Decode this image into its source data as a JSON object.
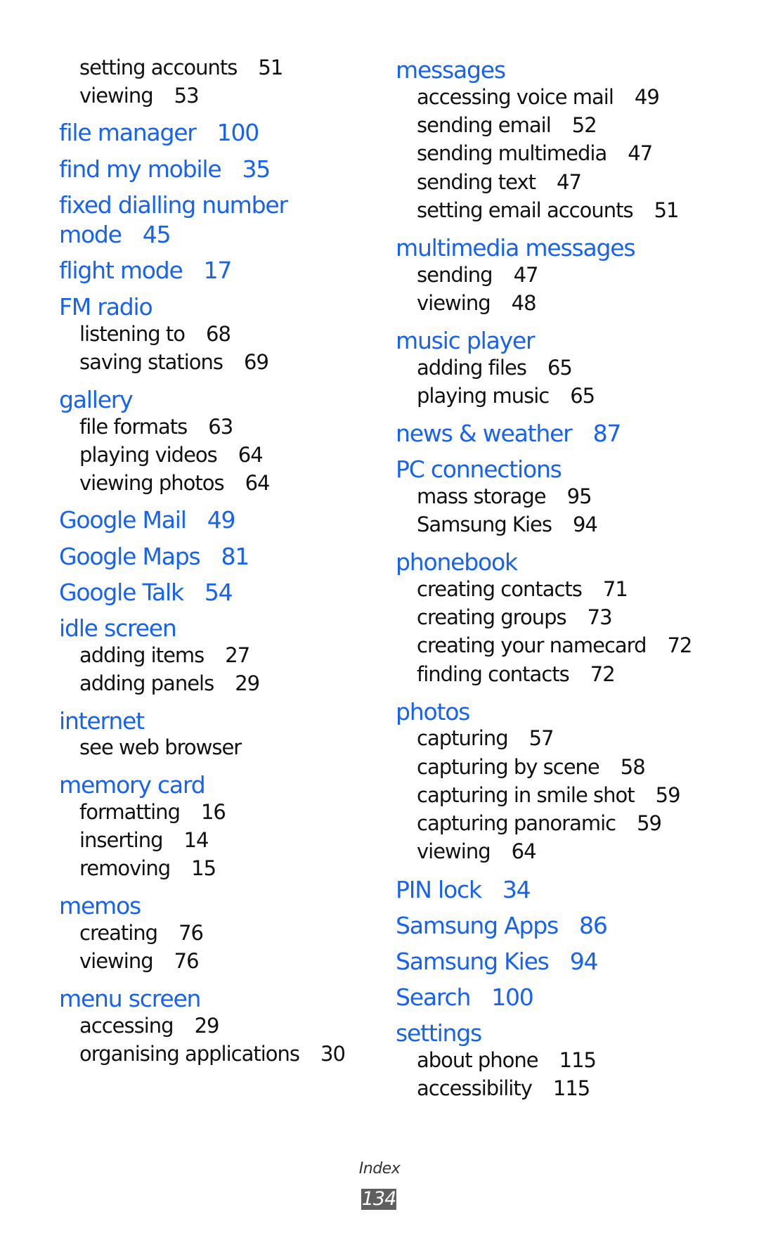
{
  "left_column": [
    {
      "type": "sub",
      "text": "setting accounts",
      "page": "51"
    },
    {
      "type": "sub",
      "text": "viewing",
      "page": "53"
    },
    {
      "type": "head",
      "text": "file manager",
      "page": "100"
    },
    {
      "type": "head",
      "text": "find my mobile",
      "page": "35"
    },
    {
      "type": "head",
      "text": "fixed dialling number",
      "page": ""
    },
    {
      "type": "head",
      "text": "mode",
      "page": "45"
    },
    {
      "type": "head",
      "text": "flight mode",
      "page": "17"
    },
    {
      "type": "head",
      "text": "FM radio",
      "page": ""
    },
    {
      "type": "sub",
      "text": "listening to",
      "page": "68"
    },
    {
      "type": "sub",
      "text": "saving stations",
      "page": "69"
    },
    {
      "type": "head",
      "text": "gallery",
      "page": ""
    },
    {
      "type": "sub",
      "text": "file formats",
      "page": "63"
    },
    {
      "type": "sub",
      "text": "playing videos",
      "page": "64"
    },
    {
      "type": "sub",
      "text": "viewing photos",
      "page": "64"
    },
    {
      "type": "head",
      "text": "Google Mail",
      "page": "49"
    },
    {
      "type": "head",
      "text": "Google Maps",
      "page": "81"
    },
    {
      "type": "head",
      "text": "Google Talk",
      "page": "54"
    },
    {
      "type": "head",
      "text": "idle screen",
      "page": ""
    },
    {
      "type": "sub",
      "text": "adding items",
      "page": "27"
    },
    {
      "type": "sub",
      "text": "adding panels",
      "page": "29"
    },
    {
      "type": "head",
      "text": "internet",
      "page": ""
    },
    {
      "type": "sub",
      "text": "see web browser",
      "page": ""
    },
    {
      "type": "head",
      "text": "memory card",
      "page": ""
    },
    {
      "type": "sub",
      "text": "formatting",
      "page": "16"
    },
    {
      "type": "sub",
      "text": "inserting",
      "page": "14"
    },
    {
      "type": "sub",
      "text": "removing",
      "page": "15"
    },
    {
      "type": "head",
      "text": "memos",
      "page": ""
    },
    {
      "type": "sub",
      "text": "creating",
      "page": "76"
    },
    {
      "type": "sub",
      "text": "viewing",
      "page": "76"
    },
    {
      "type": "head",
      "text": "menu screen",
      "page": ""
    },
    {
      "type": "sub",
      "text": "accessing",
      "page": "29"
    },
    {
      "type": "sub",
      "text": "organising applications",
      "page": "30"
    }
  ],
  "right_column": [
    {
      "type": "head",
      "text": "messages",
      "page": ""
    },
    {
      "type": "sub",
      "text": "accessing voice mail",
      "page": "49"
    },
    {
      "type": "sub",
      "text": "sending email",
      "page": "52"
    },
    {
      "type": "sub",
      "text": "sending multimedia",
      "page": "47"
    },
    {
      "type": "sub",
      "text": "sending text",
      "page": "47"
    },
    {
      "type": "sub",
      "text": "setting email accounts",
      "page": "51"
    },
    {
      "type": "head",
      "text": "multimedia messages",
      "page": ""
    },
    {
      "type": "sub",
      "text": "sending",
      "page": "47"
    },
    {
      "type": "sub",
      "text": "viewing",
      "page": "48"
    },
    {
      "type": "head",
      "text": "music player",
      "page": ""
    },
    {
      "type": "sub",
      "text": "adding files",
      "page": "65"
    },
    {
      "type": "sub",
      "text": "playing music",
      "page": "65"
    },
    {
      "type": "head",
      "text": "news & weather",
      "page": "87"
    },
    {
      "type": "head",
      "text": "PC connections",
      "page": ""
    },
    {
      "type": "sub",
      "text": "mass storage",
      "page": "95"
    },
    {
      "type": "sub",
      "text": "Samsung Kies",
      "page": "94"
    },
    {
      "type": "head",
      "text": "phonebook",
      "page": ""
    },
    {
      "type": "sub",
      "text": "creating contacts",
      "page": "71"
    },
    {
      "type": "sub",
      "text": "creating groups",
      "page": "73"
    },
    {
      "type": "sub",
      "text": "creating your namecard",
      "page": "72"
    },
    {
      "type": "sub",
      "text": "finding contacts",
      "page": "72"
    },
    {
      "type": "head",
      "text": "photos",
      "page": ""
    },
    {
      "type": "sub",
      "text": "capturing",
      "page": "57"
    },
    {
      "type": "sub",
      "text": "capturing by scene",
      "page": "58"
    },
    {
      "type": "sub",
      "text": "capturing in smile shot",
      "page": "59"
    },
    {
      "type": "sub",
      "text": "capturing panoramic",
      "page": "59"
    },
    {
      "type": "sub",
      "text": "viewing",
      "page": "64"
    },
    {
      "type": "head",
      "text": "PIN lock",
      "page": "34"
    },
    {
      "type": "head",
      "text": "Samsung Apps",
      "page": "86"
    },
    {
      "type": "head",
      "text": "Samsung Kies",
      "page": "94"
    },
    {
      "type": "head",
      "text": "Search",
      "page": "100"
    },
    {
      "type": "head",
      "text": "settings",
      "page": ""
    },
    {
      "type": "sub",
      "text": "about phone",
      "page": "115"
    },
    {
      "type": "sub",
      "text": "accessibility",
      "page": "115"
    }
  ],
  "footer": {
    "section_label": "Index",
    "page_number": "134"
  },
  "colors": {
    "heading": "#1762f0",
    "subentry": "#111111",
    "page_badge": "#5f5f5f"
  }
}
